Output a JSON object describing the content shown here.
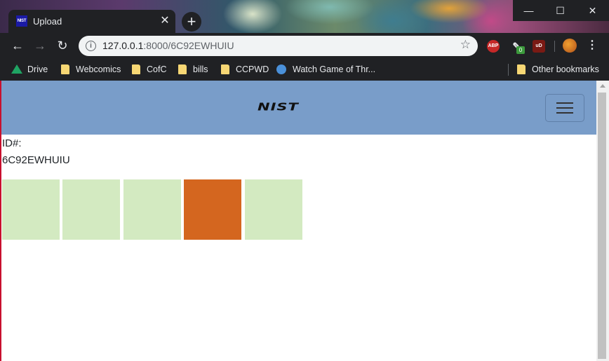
{
  "browser": {
    "tab": {
      "title": "Upload",
      "favicon_text": "NIST"
    },
    "url": {
      "host": "127.0.0.1",
      "path": ":8000/6C92EWHUIU"
    },
    "extensions": {
      "abp": "ABP",
      "sync_badge": "0",
      "ublock": "uD"
    },
    "bookmarks": [
      "Drive",
      "Webcomics",
      "CofC",
      "bills",
      "CCPWD",
      "Watch Game of Thr..."
    ],
    "other_bookmarks": "Other bookmarks"
  },
  "page": {
    "logo": "NIST",
    "id_label": "ID#:",
    "id_value": "6C92EWHUIU",
    "tiles": [
      {
        "color": "#d3eac1",
        "state": "default"
      },
      {
        "color": "#d3eac1",
        "state": "default"
      },
      {
        "color": "#d3eac1",
        "state": "default"
      },
      {
        "color": "#d4661f",
        "state": "selected"
      },
      {
        "color": "#d3eac1",
        "state": "default"
      }
    ]
  },
  "colors": {
    "navbar": "#799dc9",
    "tile_default": "#d3eac1",
    "tile_selected": "#d4661f",
    "chrome_dark": "#202124"
  }
}
